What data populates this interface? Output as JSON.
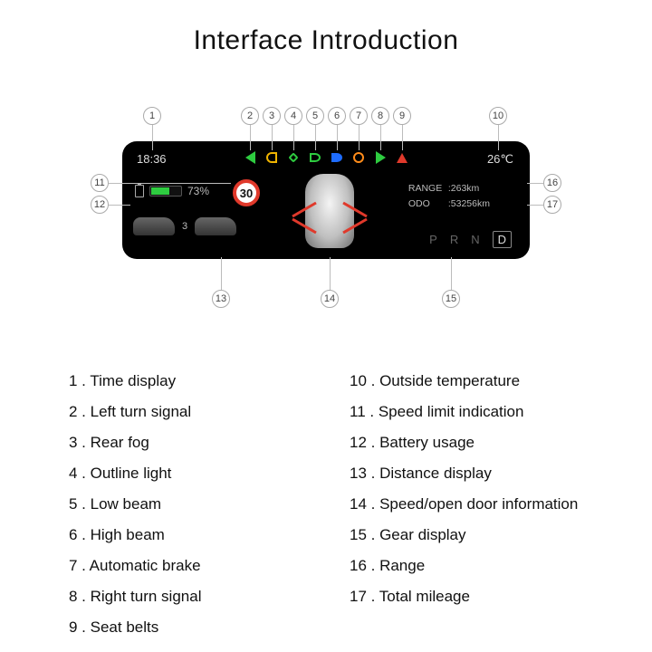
{
  "title": "Interface Introduction",
  "device": {
    "time": "18:36",
    "temperature": "26℃",
    "battery_pct": "73%",
    "speed_limit": "30",
    "distance_between": "3",
    "range_label": "RANGE",
    "range_value": ":263km",
    "odo_label": "ODO",
    "odo_value": ":53256km",
    "gears": [
      "P",
      "R",
      "N",
      "D"
    ],
    "gear_active_index": 3
  },
  "callouts": {
    "1": "1",
    "2": "2",
    "3": "3",
    "4": "4",
    "5": "5",
    "6": "6",
    "7": "7",
    "8": "8",
    "9": "9",
    "10": "10",
    "11": "11",
    "12": "12",
    "13": "13",
    "14": "14",
    "15": "15",
    "16": "16",
    "17": "17"
  },
  "legend": {
    "left": [
      "1 .  Time display",
      "2 .  Left turn signal",
      "3 .  Rear fog",
      "4 .  Outline light",
      "5 .  Low beam",
      "6 .  High beam",
      "7 .  Automatic brake",
      "8 .  Right turn signal",
      "9 .  Seat belts"
    ],
    "right": [
      "10 . Outside temperature",
      "11 . Speed limit indication",
      "12 . Battery usage",
      "13 . Distance display",
      "14 . Speed/open door information",
      "15 . Gear display",
      "16 . Range",
      "17 . Total mileage"
    ]
  }
}
